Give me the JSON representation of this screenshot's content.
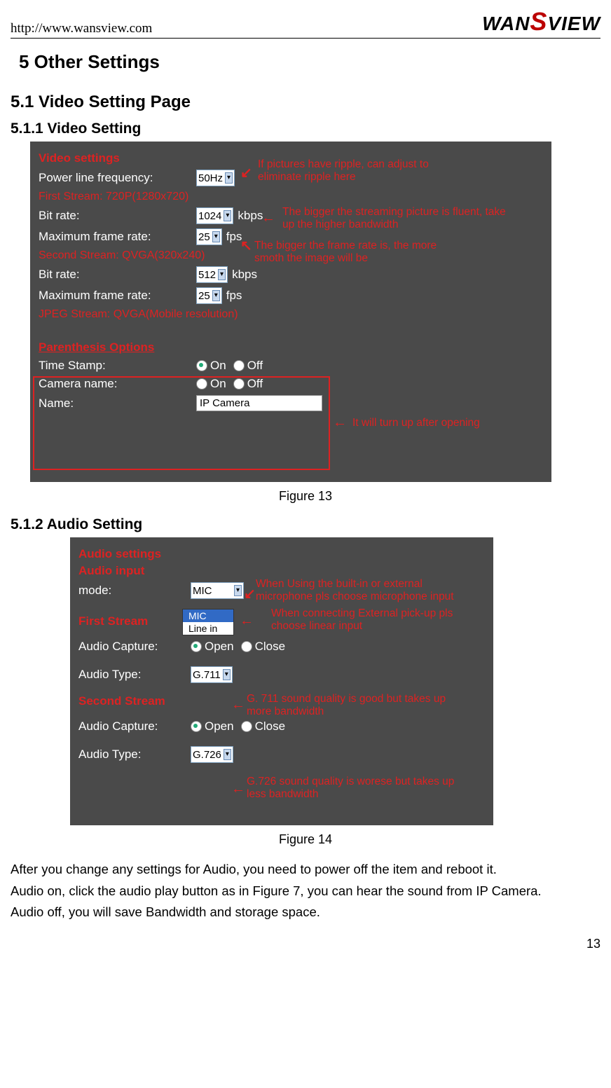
{
  "header": {
    "url": "http://www.wansview.com",
    "logo_left": "WAN",
    "logo_s": "S",
    "logo_right": "VIEW"
  },
  "h1": "5   Other Settings",
  "h2_1": "5.1   Video Setting Page",
  "h3_1": "5.1.1   Video Setting",
  "video": {
    "title": "Video settings",
    "plf_label": "Power line frequency:",
    "plf_value": "50Hz",
    "first_stream": "First Stream: 720P(1280x720)",
    "bitrate_label": "Bit rate:",
    "bitrate1_value": "1024",
    "kbps": "kbps",
    "mfr_label": "Maximum frame rate:",
    "mfr1_value": "25",
    "fps": "fps",
    "second_stream": "Second Stream: QVGA(320x240)",
    "bitrate2_value": "512",
    "mfr2_value": "25",
    "jpeg_stream": "JPEG Stream: QVGA(Mobile resolution)",
    "parenth": "Parenthesis Options",
    "ts_label": "Time Stamp:",
    "cam_label": "Camera name:",
    "on": "On",
    "off": "Off",
    "name_label": "Name:",
    "name_value": "IP Camera",
    "anno1": "If pictures have ripple, can adjust to eliminate ripple here",
    "anno2": "The bigger the streaming picture is fluent, take up the higher bandwidth",
    "anno3": "The bigger the frame rate is, the more smoth the image will be",
    "anno4": "It will turn up after opening"
  },
  "fig13": "Figure 13",
  "h3_2": "5.1.2   Audio Setting",
  "audio": {
    "title": "Audio settings",
    "input_title": "Audio input",
    "mode_label": "mode:",
    "mode_value": "MIC",
    "mode_opt1": "MIC",
    "mode_opt2": "Line in",
    "first_stream": "First Stream",
    "capture_label": "Audio Capture:",
    "open": "Open",
    "close": "Close",
    "type_label": "Audio Type:",
    "type1_value": "G.711",
    "second_stream": "Second Stream",
    "type2_value": "G.726",
    "anno1": "When Using the built-in or external microphone pls choose microphone input",
    "anno2": "When connecting External pick-up pls choose linear input",
    "anno3": "G. 711 sound quality is good but takes up more bandwidth",
    "anno4": "G.726 sound quality is worese but takes up less bandwidth"
  },
  "fig14": "Figure 14",
  "para1": "After you change any settings for Audio, you need to power off the item and reboot it.",
  "para2": "Audio on, click the audio play button as in Figure 7, you can hear the sound from IP Camera.",
  "para3": "Audio off, you will save Bandwidth and storage space.",
  "page": "13"
}
